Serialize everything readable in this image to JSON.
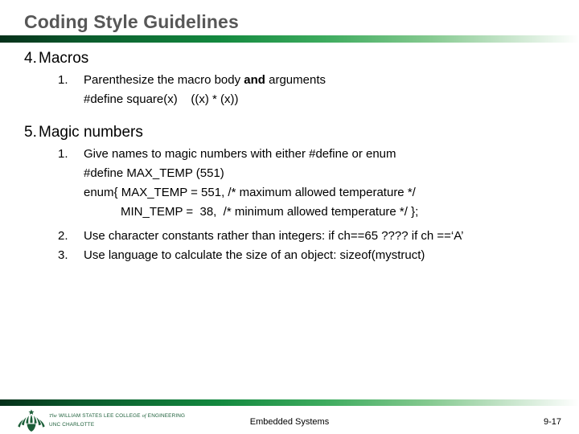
{
  "slide": {
    "title": "Coding Style Guidelines",
    "accent_color": "#13893f",
    "accent_dark": "#05301a",
    "title_color": "#575757",
    "sections": [
      {
        "number": "4.",
        "heading": "Macros",
        "items": [
          {
            "number": "1.",
            "text_before_bold": "Parenthesize the macro body ",
            "bold": "and",
            "text_after_bold": " arguments",
            "code_lines": [
              {
                "text": "#define square(x)    ((x) * (x))",
                "deep": false
              }
            ]
          }
        ]
      },
      {
        "number": "5.",
        "heading": "Magic numbers",
        "items": [
          {
            "number": "1.",
            "text_before_bold": "Give names to magic numbers with either #define or enum",
            "bold": "",
            "text_after_bold": "",
            "code_lines": [
              {
                "text": "#define MAX_TEMP (551)",
                "deep": false
              },
              {
                "text": "enum{ MAX_TEMP = 551, /* maximum allowed temperature */",
                "deep": false
              },
              {
                "text": "MIN_TEMP =  38,  /* minimum allowed temperature */ };",
                "deep": true
              }
            ]
          },
          {
            "number": "2.",
            "text_before_bold": "Use character constants rather than integers: if ch==65 ????  if ch ==‘A’",
            "bold": "",
            "text_after_bold": "",
            "code_lines": []
          },
          {
            "number": "3.",
            "text_before_bold": "Use language to calculate the size of an object: sizeof(mystruct)",
            "bold": "",
            "text_after_bold": "",
            "code_lines": []
          }
        ]
      }
    ]
  },
  "footer": {
    "logo_line1": "The WILLIAM STATES LEE COLLEGE of ENGINEERING",
    "logo_line2": "UNC CHARLOTTE",
    "logo_the": "The",
    "logo_main1": " WILLIAM STATES LEE COLLEGE ",
    "logo_of": "of",
    "logo_main2": " ENGINEERING",
    "center_text": "Embedded Systems",
    "page_number": "9-17",
    "logo_color": "#1b5e38"
  }
}
